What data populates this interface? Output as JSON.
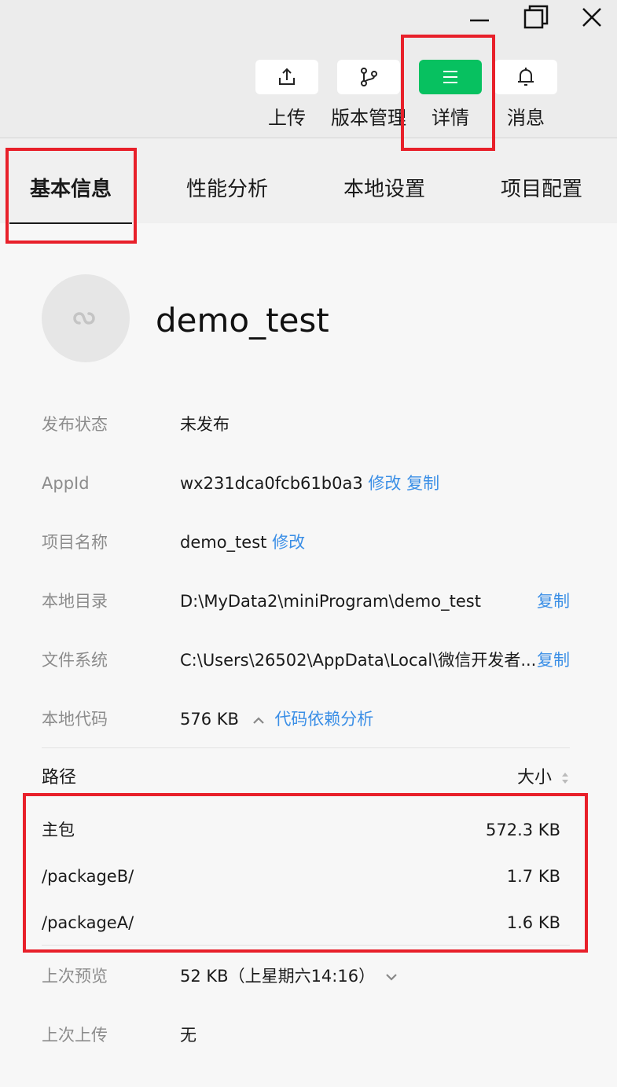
{
  "toolbar": {
    "upload_label": "上传",
    "version_label": "版本管理",
    "details_label": "详情",
    "messages_label": "消息"
  },
  "tabs": [
    "基本信息",
    "性能分析",
    "本地设置",
    "项目配置"
  ],
  "project": {
    "name": "demo_test"
  },
  "info": {
    "status_key": "发布状态",
    "status_value": "未发布",
    "appid_key": "AppId",
    "appid_value": "wx231dca0fcb61b0a3",
    "appid_edit": "修改",
    "appid_copy": "复制",
    "name_key": "项目名称",
    "name_value": "demo_test",
    "name_edit": "修改",
    "dir_key": "本地目录",
    "dir_value": "D:\\MyData2\\miniProgram\\demo_test",
    "dir_copy": "复制",
    "fs_key": "文件系统",
    "fs_value": "C:\\Users\\26502\\AppData\\Local\\微信开发者...",
    "fs_copy": "复制",
    "code_key": "本地代码",
    "code_value": "576 KB",
    "code_analysis": "代码依赖分析"
  },
  "packages": {
    "header_path": "路径",
    "header_size": "大小",
    "rows": [
      {
        "path": "主包",
        "size": "572.3 KB"
      },
      {
        "path": "/packageB/",
        "size": "1.7 KB"
      },
      {
        "path": "/packageA/",
        "size": "1.6 KB"
      }
    ]
  },
  "history": {
    "preview_key": "上次预览",
    "preview_value": "52 KB（上星期六14:16）",
    "upload_key": "上次上传",
    "upload_value": "无"
  },
  "colors": {
    "accent": "#07c160",
    "link": "#3a8ee6",
    "highlight": "#e8202a"
  },
  "icons": [
    "minimize-icon",
    "restore-icon",
    "close-icon",
    "upload-icon",
    "branch-icon",
    "menu-icon",
    "bell-icon",
    "miniprogram-logo-icon",
    "chevron-up-icon",
    "sort-icon",
    "chevron-down-icon"
  ]
}
